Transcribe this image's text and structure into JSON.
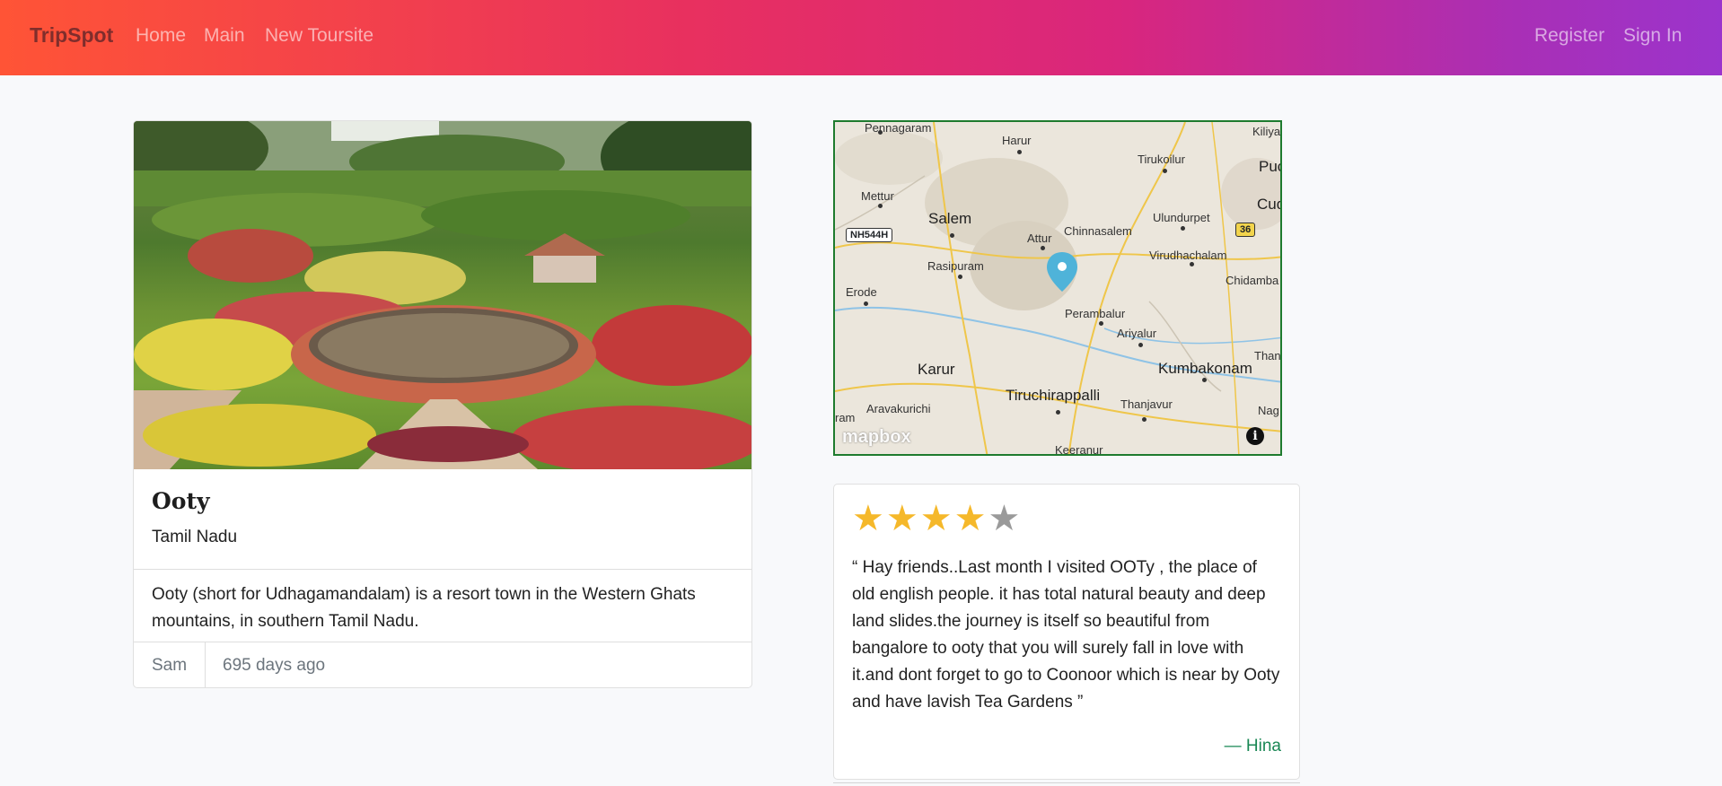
{
  "navbar": {
    "brand": "TripSpot",
    "links": [
      "Home",
      "Main",
      "New Toursite"
    ],
    "auth": [
      "Register",
      "Sign In"
    ]
  },
  "campground": {
    "title": "Ooty",
    "location": "Tamil Nadu",
    "description": "Ooty (short for Udhagamandalam) is a resort town in the Western Ghats mountains, in southern Tamil Nadu.",
    "author": "Sam",
    "posted": "695 days ago"
  },
  "map": {
    "attribution": "mapbox",
    "info_label": "i",
    "labels": [
      "Pennagaram",
      "Harur",
      "Kiliya",
      "Tirukoilur",
      "Puc",
      "Mettur",
      "Salem",
      "Cudd",
      "Ulundurpet",
      "NH544H",
      "Attur",
      "Chinnasalem",
      "36",
      "Rasipuram",
      "Virudhachalam",
      "Chidamba",
      "Erode",
      "Perambalur",
      "Ariyalur",
      "Than",
      "Karur",
      "Kumbakonam",
      "Tiruchirappalli",
      "Thanjavur",
      "Aravakurichi",
      "Nag",
      "ram",
      "Keeranur"
    ],
    "marker_color": "#4fb3d9"
  },
  "review": {
    "rating": 4,
    "max_rating": 5,
    "text": "“ Hay friends..Last month I visited OOTy , the place of old english people. it has total natural beauty and deep land slides.the journey is itself so beautiful from bangalore to ooty that you will surely fall in love with it.and dont forget to go to Coonoor which is near by Ooty and have lavish Tea Gardens ”",
    "author": "— Hina",
    "star_on_color": "#f5b82a",
    "star_off_color": "#9a9a9a"
  }
}
